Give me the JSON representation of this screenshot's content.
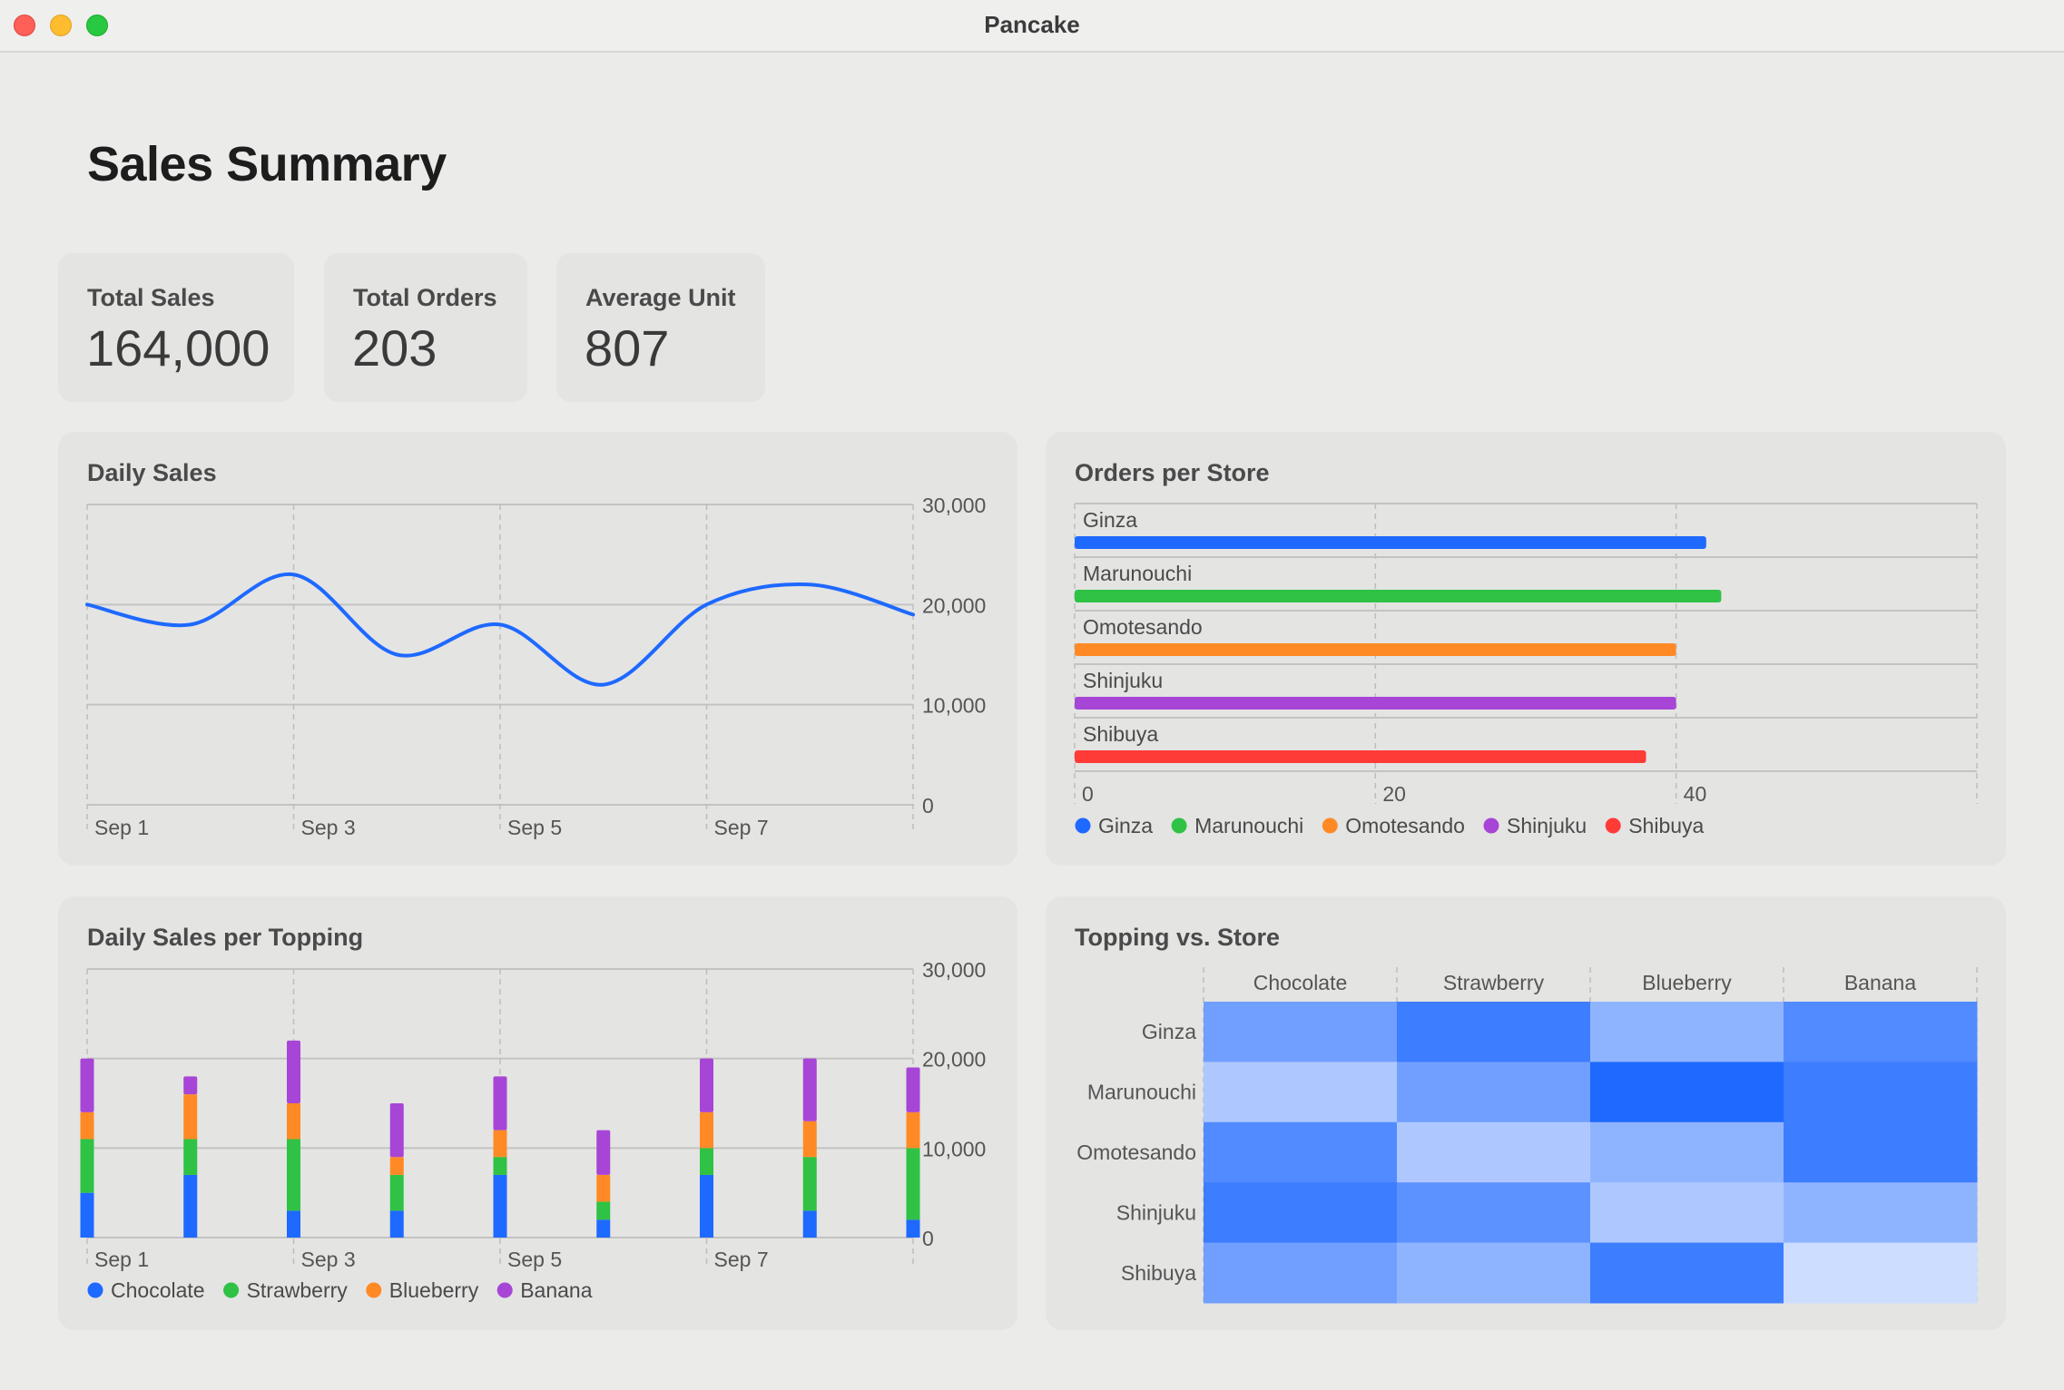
{
  "window": {
    "title": "Pancake"
  },
  "page_title": "Sales Summary",
  "kpis": [
    {
      "label": "Total Sales",
      "value": "164,000"
    },
    {
      "label": "Total Orders",
      "value": "203"
    },
    {
      "label": "Average Unit",
      "value": "807"
    }
  ],
  "colors": {
    "Chocolate": "#1e69ff",
    "Strawberry": "#2fc244",
    "Blueberry": "#ff8a25",
    "Banana": "#a745d6",
    "Ginza": "#1e69ff",
    "Marunouchi": "#2fc244",
    "Omotesando": "#ff8a25",
    "Shinjuku": "#a745d6",
    "Shibuya": "#ff3b38"
  },
  "charts": {
    "daily_sales": {
      "title": "Daily Sales"
    },
    "orders_per_store": {
      "title": "Orders per Store"
    },
    "daily_topping": {
      "title": "Daily Sales per Topping"
    },
    "heatmap": {
      "title": "Topping vs. Store"
    }
  },
  "chart_data": [
    {
      "id": "daily_sales",
      "type": "line",
      "title": "Daily Sales",
      "x": [
        "Sep 1",
        "Sep 2",
        "Sep 3",
        "Sep 4",
        "Sep 5",
        "Sep 6",
        "Sep 7",
        "Sep 8",
        "Sep 9"
      ],
      "x_tick_labels": [
        "Sep 1",
        "Sep 3",
        "Sep 5",
        "Sep 7"
      ],
      "series": [
        {
          "values": [
            20000,
            18000,
            23000,
            15000,
            18000,
            12000,
            20000,
            22000,
            19000
          ]
        }
      ],
      "ylim": [
        0,
        30000
      ],
      "y_ticks": [
        0,
        10000,
        20000,
        30000
      ],
      "y_tick_labels": [
        "0",
        "10,000",
        "20,000",
        "30,000"
      ],
      "y_axis_side": "right",
      "grid": true
    },
    {
      "id": "orders_per_store",
      "type": "bar",
      "orientation": "horizontal",
      "title": "Orders per Store",
      "categories": [
        "Ginza",
        "Marunouchi",
        "Omotesando",
        "Shinjuku",
        "Shibuya"
      ],
      "values": [
        42,
        43,
        40,
        40,
        38
      ],
      "xlim": [
        0,
        60
      ],
      "x_ticks": [
        0,
        20,
        40
      ],
      "x_tick_labels": [
        "0",
        "20",
        "40"
      ],
      "legend": [
        "Ginza",
        "Marunouchi",
        "Omotesando",
        "Shinjuku",
        "Shibuya"
      ],
      "legend_position": "bottom-left",
      "grid": true
    },
    {
      "id": "daily_topping",
      "type": "bar",
      "stacked": true,
      "title": "Daily Sales per Topping",
      "categories": [
        "Sep 1",
        "Sep 2",
        "Sep 3",
        "Sep 4",
        "Sep 5",
        "Sep 6",
        "Sep 7",
        "Sep 8",
        "Sep 9"
      ],
      "x_tick_labels": [
        "Sep 1",
        "Sep 3",
        "Sep 5",
        "Sep 7"
      ],
      "series": [
        {
          "name": "Chocolate",
          "values": [
            5000,
            7000,
            3000,
            3000,
            7000,
            2000,
            7000,
            3000,
            2000
          ]
        },
        {
          "name": "Strawberry",
          "values": [
            6000,
            4000,
            8000,
            4000,
            2000,
            2000,
            3000,
            6000,
            8000
          ]
        },
        {
          "name": "Blueberry",
          "values": [
            3000,
            5000,
            4000,
            2000,
            3000,
            3000,
            4000,
            4000,
            4000
          ]
        },
        {
          "name": "Banana",
          "values": [
            6000,
            2000,
            7000,
            6000,
            6000,
            5000,
            6000,
            7000,
            5000
          ]
        }
      ],
      "ylim": [
        0,
        30000
      ],
      "y_ticks": [
        0,
        10000,
        20000,
        30000
      ],
      "y_tick_labels": [
        "0",
        "10,000",
        "20,000",
        "30,000"
      ],
      "y_axis_side": "right",
      "legend": [
        "Chocolate",
        "Strawberry",
        "Blueberry",
        "Banana"
      ],
      "legend_position": "bottom-left",
      "grid": true
    },
    {
      "id": "heatmap",
      "type": "heatmap",
      "title": "Topping vs. Store",
      "columns": [
        "Chocolate",
        "Strawberry",
        "Blueberry",
        "Banana"
      ],
      "rows": [
        "Ginza",
        "Marunouchi",
        "Omotesando",
        "Shinjuku",
        "Shibuya"
      ],
      "values": [
        [
          0.6,
          0.85,
          0.45,
          0.75
        ],
        [
          0.3,
          0.6,
          1.0,
          0.85
        ],
        [
          0.75,
          0.3,
          0.45,
          0.85
        ],
        [
          0.85,
          0.7,
          0.3,
          0.45
        ],
        [
          0.6,
          0.45,
          0.85,
          0.15
        ]
      ],
      "range": [
        0,
        1
      ],
      "color": "#1e69ff"
    }
  ]
}
